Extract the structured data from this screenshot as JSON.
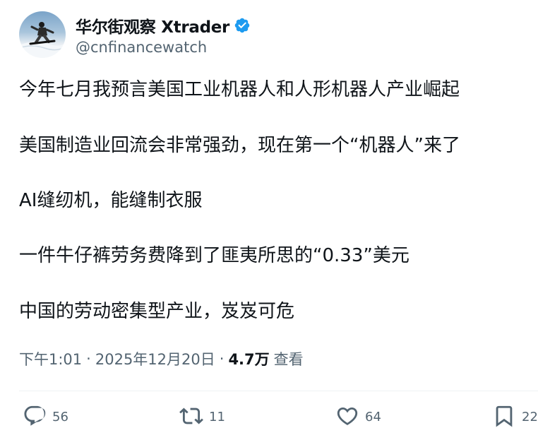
{
  "author": {
    "display_name": "华尔街观察 Xtrader",
    "handle": "@cnfinancewatch",
    "verified": true,
    "verified_color": "#1d9bf0"
  },
  "post": {
    "paragraphs": [
      "今年七月我预言美国工业机器人和人形机器人产业崛起",
      "美国制造业回流会非常强劲，现在第一个“机器人”来了",
      "AI缝纫机，能缝制衣服",
      "一件牛仔裤劳务费降到了匪夷所思的“0.33”美元",
      "中国的劳动密集型产业，岌岌可危"
    ],
    "time": "下午1:01",
    "date": "2025年12月20日",
    "separator": "·",
    "views_count": "4.7万",
    "views_label": "查看"
  },
  "actions": {
    "reply": {
      "icon": "reply-icon",
      "count": "56"
    },
    "repost": {
      "icon": "repost-icon",
      "count": "11"
    },
    "like": {
      "icon": "heart-icon",
      "count": "64"
    },
    "bookmark": {
      "icon": "bookmark-icon",
      "count": "22"
    }
  }
}
